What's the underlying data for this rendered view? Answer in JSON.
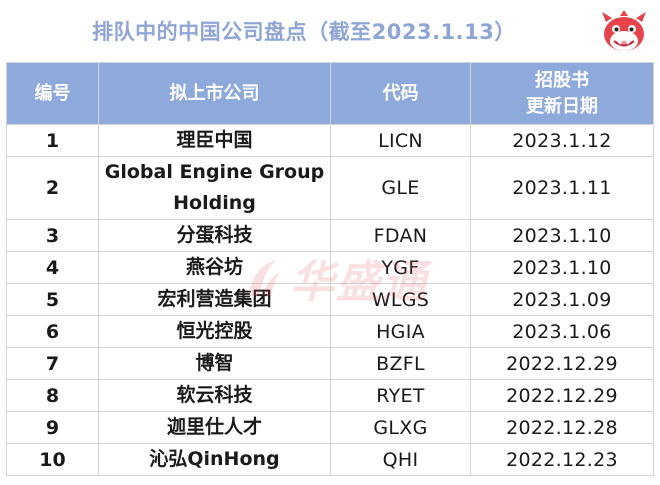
{
  "title": "排队中的中国公司盘点（截至2023.1.13）",
  "watermark": "华盛通",
  "table": {
    "headers": {
      "num": "编号",
      "company": "拟上市公司",
      "code": "代码",
      "date_line1": "招股书",
      "date_line2": "更新日期"
    },
    "rows": [
      {
        "num": "1",
        "company": "理臣中国",
        "code": "LICN",
        "date": "2023.1.12"
      },
      {
        "num": "2",
        "company_line1": "Global Engine Group",
        "company_line2": "Holding",
        "code": "GLE",
        "date": "2023.1.11"
      },
      {
        "num": "3",
        "company": "分蛋科技",
        "code": "FDAN",
        "date": "2023.1.10"
      },
      {
        "num": "4",
        "company": "燕谷坊",
        "code": "YGF",
        "date": "2023.1.10"
      },
      {
        "num": "5",
        "company": "宏利营造集团",
        "code": "WLGS",
        "date": "2023.1.09"
      },
      {
        "num": "6",
        "company": "恒光控股",
        "code": "HGIA",
        "date": "2023.1.06"
      },
      {
        "num": "7",
        "company": "博智",
        "code": "BZFL",
        "date": "2022.12.29"
      },
      {
        "num": "8",
        "company": "软云科技",
        "code": "RYET",
        "date": "2022.12.29"
      },
      {
        "num": "9",
        "company": "迦里仕人才",
        "code": "GLXG",
        "date": "2022.12.28"
      },
      {
        "num": "10",
        "company": "沁弘QinHong",
        "code": "QHI",
        "date": "2022.12.23"
      }
    ]
  },
  "colors": {
    "header_bg": "#8ea9dc",
    "title_text": "#8fa5d6",
    "watermark": "#e85a5a"
  },
  "icons": {
    "mascot": "red-dragon-mascot-icon",
    "watermark_logo": "huashengtong-logo-icon"
  }
}
